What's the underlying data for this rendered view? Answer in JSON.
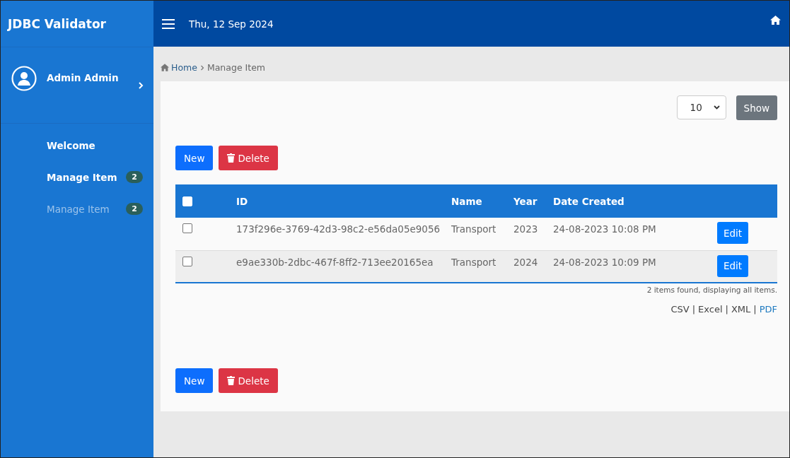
{
  "sidebar": {
    "brand": "JDBC Validator",
    "user": {
      "name": "Admin Admin"
    },
    "items": [
      {
        "label": "Welcome",
        "muted": false
      },
      {
        "label": "Manage Item",
        "badge": "2",
        "muted": false
      },
      {
        "label": "Manage Item",
        "badge": "2",
        "muted": true
      }
    ]
  },
  "topbar": {
    "date": "Thu, 12 Sep 2024"
  },
  "breadcrumb": [
    {
      "label": "Home"
    },
    {
      "label": "Manage Item"
    }
  ],
  "page_size": {
    "value": "10",
    "button": "Show"
  },
  "actions_top": [
    {
      "label": "New",
      "kind": "new"
    },
    {
      "label": "Delete",
      "kind": "delete"
    }
  ],
  "table": {
    "select_all": {
      "checked": false
    },
    "columns": [
      "ID",
      "Name",
      "Year",
      "Date Created"
    ],
    "rows": [
      {
        "checked": false,
        "cells": [
          "173f296e-3769-42d3-98c2-e56da05e9056",
          "Transport",
          "2023",
          "24-08-2023 10:08 PM"
        ],
        "action": "Edit"
      },
      {
        "checked": false,
        "cells": [
          "e9ae330b-2dbc-467f-8ff2-713ee20165ea",
          "Transport",
          "2024",
          "24-08-2023 10:09 PM"
        ],
        "action": "Edit"
      }
    ]
  },
  "summary": "2 items found, displaying all items.",
  "exports": {
    "separator": "|",
    "links": [
      {
        "label": "CSV",
        "visited": true
      },
      {
        "label": "Excel",
        "visited": true
      },
      {
        "label": "XML",
        "visited": true
      },
      {
        "label": "PDF",
        "visited": false
      }
    ]
  },
  "actions_bottom": [
    {
      "label": "New",
      "kind": "new"
    },
    {
      "label": "Delete",
      "kind": "delete"
    }
  ]
}
